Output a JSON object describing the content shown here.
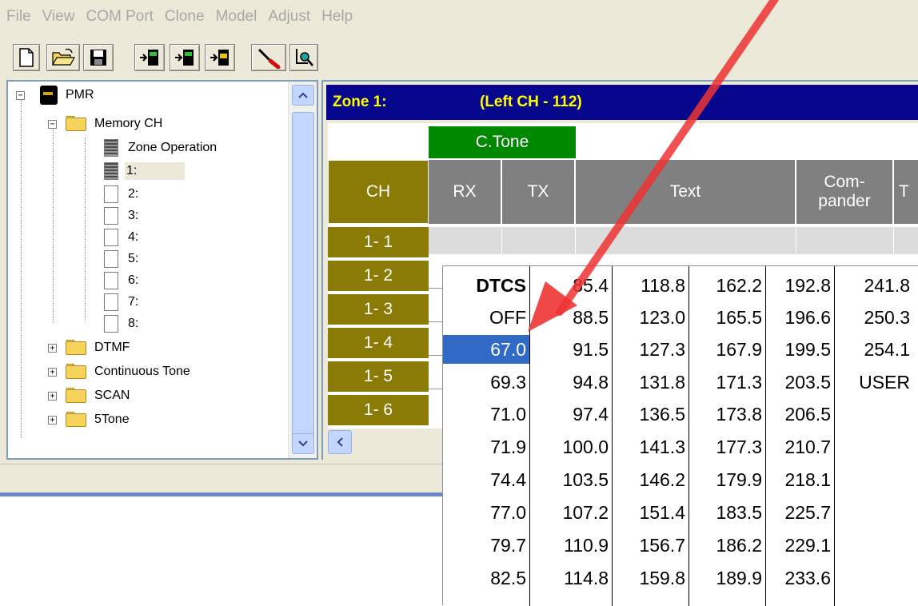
{
  "menu": {
    "items": [
      "File",
      "View",
      "COM Port",
      "Clone",
      "Model",
      "Adjust",
      "Help"
    ]
  },
  "toolbar": {
    "buttons": [
      "new-file-icon",
      "open-folder-icon",
      "save-icon",
      "read-from-radio-icon",
      "write-to-radio-icon",
      "clone-icon",
      "tools-icon",
      "print-preview-icon"
    ]
  },
  "tree": {
    "root": "PMR",
    "memory_ch": "Memory CH",
    "zone_operation": "Zone Operation",
    "channels": [
      "1:",
      "2:",
      "3:",
      "4:",
      "5:",
      "6:",
      "7:",
      "8:"
    ],
    "folders": [
      "DTMF",
      "Continuous Tone",
      "SCAN",
      "5Tone"
    ]
  },
  "zone": {
    "label": "Zone 1:",
    "left_ch": "(Left CH - 112)"
  },
  "grid": {
    "group_header": "C.Tone",
    "headers": {
      "ch": "CH",
      "rx": "RX",
      "tx": "TX",
      "text": "Text",
      "compander_1": "Com-",
      "compander_2": "pander",
      "cut": "T"
    },
    "rows": [
      "1- 1",
      "1- 2",
      "1- 3",
      "1- 4",
      "1- 5",
      "1- 6"
    ]
  },
  "dropdown": {
    "columns": [
      [
        "DTCS",
        "OFF",
        "67.0",
        "69.3",
        "71.0",
        "71.9",
        "74.4",
        "77.0",
        "79.7",
        "82.5"
      ],
      [
        "85.4",
        "88.5",
        "91.5",
        "94.8",
        "97.4",
        "100.0",
        "103.5",
        "107.2",
        "110.9",
        "114.8"
      ],
      [
        "118.8",
        "123.0",
        "127.3",
        "131.8",
        "136.5",
        "141.3",
        "146.2",
        "151.4",
        "156.7",
        "159.8"
      ],
      [
        "162.2",
        "165.5",
        "167.9",
        "171.3",
        "173.8",
        "177.3",
        "179.9",
        "183.5",
        "186.2",
        "189.9"
      ],
      [
        "192.8",
        "196.6",
        "199.5",
        "203.5",
        "206.5",
        "210.7",
        "218.1",
        "225.7",
        "229.1",
        "233.6"
      ],
      [
        "241.8",
        "250.3",
        "254.1",
        "USER"
      ]
    ],
    "selected": "67.0"
  },
  "colors": {
    "zone_bar_bg": "#07078e",
    "zone_bar_text": "#ffff00",
    "olive_header": "#8a7a06",
    "gray_header": "#808080",
    "ctone_green": "#008800",
    "selection": "#316ac5",
    "annotation_arrow": "#ee3333"
  }
}
